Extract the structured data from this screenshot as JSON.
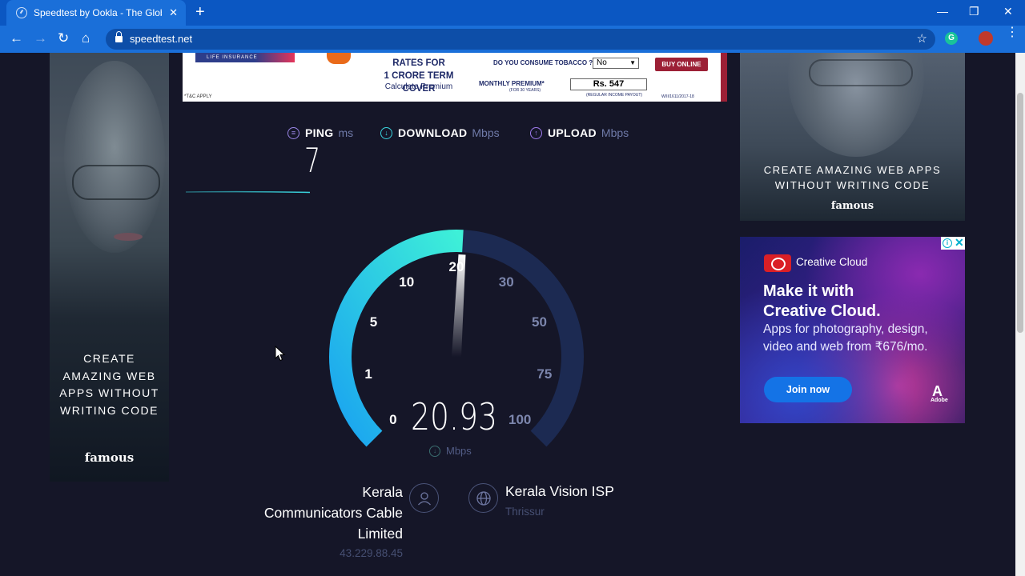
{
  "browser": {
    "tab_title": "Speedtest by Ookla - The Global",
    "tab_close": "✕",
    "new_tab": "+",
    "url": "speedtest.net",
    "win_minimize": "—",
    "win_restore": "❐",
    "win_close": "✕",
    "ext_letter": "G",
    "icons": {
      "back": "←",
      "forward": "→",
      "reload": "↻",
      "home": "⌂",
      "star": "☆",
      "menu": "⋮"
    }
  },
  "ad_left": {
    "lines": [
      "CREATE",
      "AMAZING WEB",
      "APPS WITHOUT",
      "WRITING CODE"
    ],
    "brand": "famous"
  },
  "ad_top": {
    "insurance": "LIFE INSURANCE",
    "tnc": "*T&C APPLY",
    "rates_line1": "RATES FOR",
    "rates_line2": "1 CRORE TERM COVER",
    "calc": "Calculate Premium",
    "tobacco_q": "DO YOU CONSUME TOBACCO ?",
    "tobacco_value": "No",
    "buy": "BUY ONLINE",
    "monthly_label": "MONTHLY PREMIUM*",
    "monthly_sub": "(FOR 30 YEARS)",
    "premium": "Rs. 547",
    "premium_sub": "(REGULAR INCOME PAYOUT)",
    "code": "W/II/1611/2017-18"
  },
  "ad_right1": {
    "line1": "CREATE AMAZING WEB APPS",
    "line2": "WITHOUT WRITING CODE",
    "brand": "famous"
  },
  "ad_right2": {
    "product": "Creative Cloud",
    "headline1": "Make it with",
    "headline2": "Creative Cloud.",
    "sub1": "Apps for photography, design,",
    "sub2": "video and web from ₹676/mo.",
    "cta": "Join now",
    "adobe": "Adobe",
    "adchoice_i": "i",
    "adchoice_x": "✕"
  },
  "speedtest": {
    "ping": {
      "label": "PING",
      "unit": "ms",
      "value": "7"
    },
    "download": {
      "label": "DOWNLOAD",
      "unit": "Mbps"
    },
    "upload": {
      "label": "UPLOAD",
      "unit": "Mbps"
    },
    "gauge": {
      "ticks": [
        "0",
        "1",
        "5",
        "10",
        "20",
        "30",
        "50",
        "75",
        "100"
      ],
      "current": 20.93,
      "current_text": "20.93",
      "unit": "Mbps"
    },
    "host": {
      "line1": "Kerala",
      "line2": "Communicators Cable",
      "line3": "Limited",
      "ip": "43.229.88.45"
    },
    "isp": {
      "name": "Kerala Vision ISP",
      "city": "Thrissur"
    }
  },
  "colors": {
    "accent_cyan": "#3ad6e0",
    "accent_blue": "#1aa3f0",
    "gauge_track": "#1c2a52",
    "page_bg": "#151628",
    "chrome_blue": "#1a6fd9"
  }
}
